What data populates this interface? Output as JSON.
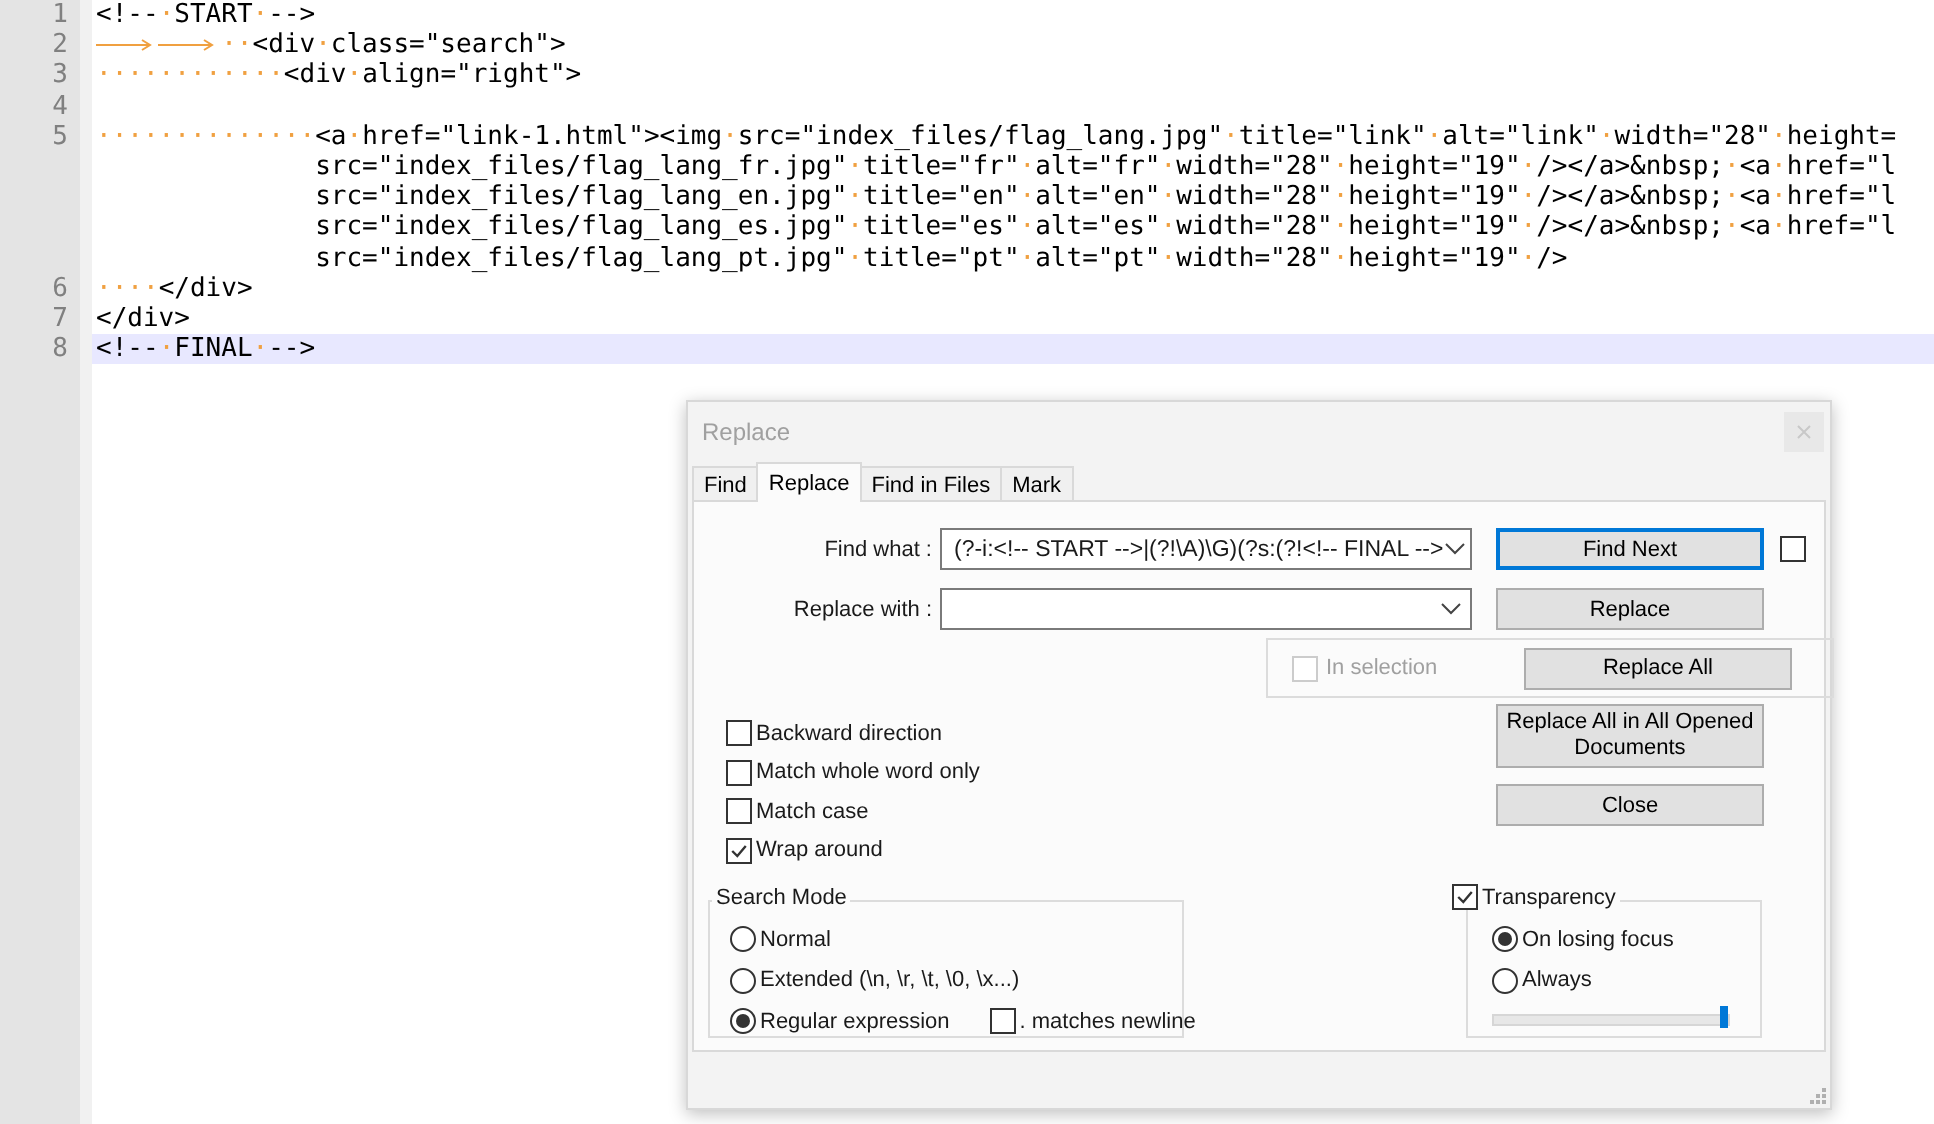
{
  "editor": {
    "lines": [
      {
        "number": "1",
        "text": "<!--·START·-->",
        "current": false
      },
      {
        "number": "2",
        "indent": [
          {
            "kind": "tab"
          },
          {
            "kind": "tab"
          }
        ],
        "text": "··<div·class=\"search\">",
        "current": false
      },
      {
        "number": "3",
        "text": "············<div·align=\"right\">",
        "current": false
      },
      {
        "number": "4",
        "current": false
      },
      {
        "number": "5",
        "text": "··············<a·href=\"link-1.html\"><img·src=\"index_files/flag_lang.jpg\"·title=\"link\"·alt=\"link\"·width=\"28\"·height=",
        "current": false,
        "wraps": [
          "src=\"index_files/flag_lang_fr.jpg\"·title=\"fr\"·alt=\"fr\"·width=\"28\"·height=\"19\"·/></a>&nbsp;·<a·href=\"l",
          "src=\"index_files/flag_lang_en.jpg\"·title=\"en\"·alt=\"en\"·width=\"28\"·height=\"19\"·/></a>&nbsp;·<a·href=\"l",
          "src=\"index_files/flag_lang_es.jpg\"·title=\"es\"·alt=\"es\"·width=\"28\"·height=\"19\"·/></a>&nbsp;·<a·href=\"l",
          "src=\"index_files/flag_lang_pt.jpg\"·title=\"pt\"·alt=\"pt\"·width=\"28\"·height=\"19\"·/>"
        ]
      },
      {
        "number": "6",
        "text": "····</div>",
        "current": false
      },
      {
        "number": "7",
        "text": "</div>",
        "current": false
      },
      {
        "number": "8",
        "text": "<!--·FINAL·-->",
        "current": true
      }
    ]
  },
  "dialog": {
    "title": "Replace",
    "tabs": [
      {
        "label": "Find",
        "selected": false
      },
      {
        "label": "Replace",
        "selected": true
      },
      {
        "label": "Find in Files",
        "selected": false
      },
      {
        "label": "Mark",
        "selected": false
      }
    ],
    "find_what": {
      "label": "Find what :",
      "value": "(?-i:<!-- START -->|(?!\\A)\\G)(?s:(?!<!-- FINAL -->"
    },
    "replace_with": {
      "label": "Replace with :"
    },
    "find_next_button": {
      "label": "Find Next",
      "focused": true
    },
    "side_checkbox": {
      "checked": false
    },
    "replace_button": {
      "label": "Replace"
    },
    "in_selection": {
      "label": "In selection",
      "checked": false,
      "disabled": true
    },
    "replace_all_button": {
      "label": "Replace All"
    },
    "options": [
      {
        "label": "Backward direction",
        "checked": false
      },
      {
        "label": "Match whole word only",
        "checked": false
      },
      {
        "label": "Match case",
        "checked": false
      },
      {
        "label": "Wrap around",
        "checked": true
      }
    ],
    "replace_all_opened_button": {
      "label": "Replace All in All Opened Documents"
    },
    "close_button": {
      "label": "Close"
    },
    "search_mode": {
      "title": "Search Mode",
      "modes": [
        {
          "label": "Normal",
          "selected": false
        },
        {
          "label": "Extended (\\n, \\r, \\t, \\0, \\x...)",
          "selected": false
        },
        {
          "label": "Regular expression",
          "selected": true
        }
      ],
      "dot_matches_newline": {
        "label": ". matches newline",
        "checked": false
      }
    },
    "transparency": {
      "label": "Transparency",
      "checked": true,
      "modes": [
        {
          "label": "On losing focus",
          "selected": true
        },
        {
          "label": "Always",
          "selected": false
        }
      ],
      "level": 1
    }
  }
}
